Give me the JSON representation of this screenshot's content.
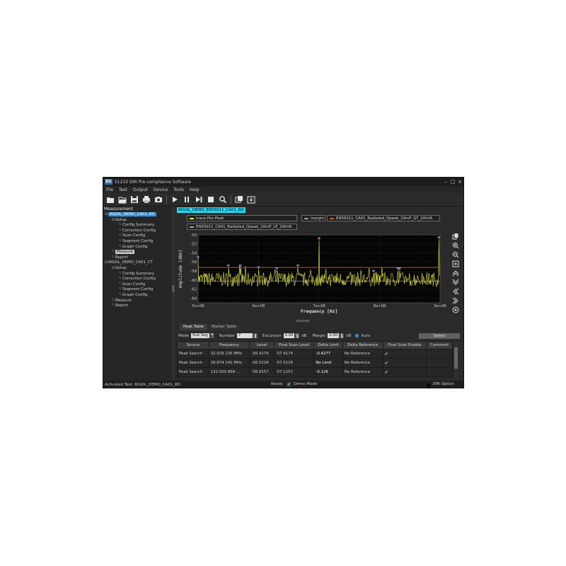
{
  "window": {
    "title": "S1210 EMI Pre-compliance Software",
    "logo": "RG"
  },
  "menu": [
    "File",
    "Test",
    "Output",
    "Device",
    "Tools",
    "Help"
  ],
  "toolbar_icons": [
    "new-folder-icon",
    "open-folder-icon",
    "save-icon",
    "print-icon",
    "camera-icon",
    "play-icon",
    "pause-icon",
    "step-icon",
    "stop-icon",
    "zoom-search-icon",
    "copy-window-icon",
    "export-icon"
  ],
  "tree": {
    "header": "Measurement",
    "nodes": [
      {
        "label": "RIGOL_DEMO_CA01_RD",
        "indent": 0,
        "toggle": "⊟",
        "state": "selected-blue"
      },
      {
        "label": "Setup",
        "indent": 1,
        "toggle": "⊟"
      },
      {
        "label": "Config Summary",
        "indent": 2
      },
      {
        "label": "Correction Config",
        "indent": 2
      },
      {
        "label": "Scan Config",
        "indent": 2
      },
      {
        "label": "Segment Config",
        "indent": 2
      },
      {
        "label": "Graph Config",
        "indent": 2
      },
      {
        "label": "Measure",
        "indent": 1,
        "state": "selected-gray"
      },
      {
        "label": "Report",
        "indent": 1
      },
      {
        "label": "RIGOL_DEMO_CA01_CT",
        "indent": 0,
        "toggle": "⊟"
      },
      {
        "label": "Setup",
        "indent": 1,
        "toggle": "⊟"
      },
      {
        "label": "Config Summary",
        "indent": 2
      },
      {
        "label": "Correction Config",
        "indent": 2
      },
      {
        "label": "Scan Config",
        "indent": 2
      },
      {
        "label": "Segment Config",
        "indent": 2
      },
      {
        "label": "Graph Config",
        "indent": 2
      },
      {
        "label": "Measure",
        "indent": 1
      },
      {
        "label": "Report",
        "indent": 1
      }
    ]
  },
  "active_test_badge": "RIGOL_DEMO_EN55011_CA01_RD",
  "legend": {
    "trace": "trace-Pos Peak",
    "margin": "margin",
    "limit1": "EN55011_CA01_Radiated_Qpeak_10mP_GT_20kVA",
    "limit2": "EN55011_CA01_Radiated_Qpeak_10mP_LE_20kVA"
  },
  "colors": {
    "trace": "#e8e84a",
    "limit1": "#d06030",
    "limit2": "#d9a35c",
    "margin": "#9a9a9a",
    "marker": "#3b6fe0",
    "marker_top": "#c040c0"
  },
  "chart_data": {
    "type": "line",
    "xlabel": "Frequency [Hz]",
    "ylabel": "Amplitude [dBm]",
    "xlim": [
      500000000,
      900000000
    ],
    "ylim": [
      -65,
      -50
    ],
    "x_ticks": [
      {
        "v": 500000000,
        "label": "5e+08"
      },
      {
        "v": 600000000,
        "label": "6e+08"
      },
      {
        "v": 700000000,
        "label": "7e+08"
      },
      {
        "v": 800000000,
        "label": "8e+08"
      },
      {
        "v": 900000000,
        "label": "9e+08"
      }
    ],
    "y_ticks": [
      -50,
      -52,
      -54,
      -56,
      -58,
      -60,
      -62,
      -64
    ],
    "limit_level": -57.2,
    "margin_level": -60.2,
    "noise_base": -59.8,
    "markers": [
      {
        "x": 500000000,
        "y": -55.4
      },
      {
        "x": 550000000,
        "y": -57.2
      },
      {
        "x": 570000000,
        "y": -57.2
      },
      {
        "x": 600000000,
        "y": -57.6
      },
      {
        "x": 630000000,
        "y": -57.8
      },
      {
        "x": 665000000,
        "y": -57.2
      },
      {
        "x": 700000000,
        "y": -51.2
      },
      {
        "x": 790000000,
        "y": -58.4
      },
      {
        "x": 830000000,
        "y": -57.8
      },
      {
        "x": 833000000,
        "y": -57.9
      },
      {
        "x": 898000000,
        "y": -51.0
      }
    ]
  },
  "side_tools": [
    "copy-icon",
    "zoom-in-icon",
    "zoom-out-icon",
    "fit-icon",
    "up-icon",
    "down-icon",
    "left-icon",
    "right-icon",
    "add-icon"
  ],
  "tabs": [
    "Peak Table",
    "Marker Table"
  ],
  "controls": {
    "mode_label": "Mode",
    "mode_value": "Sub Seg",
    "number_label": "Number",
    "number_value": "7",
    "excursion_label": "Excursion",
    "excursion_value": "0.00",
    "excursion_unit": "dB",
    "margin_label": "Margin",
    "margin_value": "0.00",
    "margin_unit": "dB",
    "auto_label": "Auto",
    "select_label": "Select"
  },
  "table": {
    "columns": [
      "Source",
      "Frequency",
      "Level",
      "Final Scan Level",
      "Delta Limit",
      "Delta Reference",
      "Final Scan Enable",
      "Comment"
    ],
    "rows": [
      [
        "Peak Search",
        "32.929 135 MHz",
        "-56.4174",
        "-57.4174",
        "-0.4277",
        "No Reference",
        "✔",
        ""
      ],
      [
        "Peak Search",
        "26.974 141 MHz",
        "-56.5126",
        "-57.0126",
        "No Limit",
        "No Reference",
        "✔",
        ""
      ],
      [
        "Peak Search",
        "132.509 868 ...",
        "-56.6157",
        "-57.1157",
        "-0.126",
        "No Reference",
        "✔",
        ""
      ],
      [
        "Peak Search",
        "139.194 837 ...",
        "-56.6873",
        "-56.6873",
        "-2.9684",
        "No Reference",
        "✔",
        ""
      ]
    ]
  },
  "status": {
    "active_test": "Activated Test: RIGOL_DEMO_CA01_RD",
    "ready": "Ready",
    "demo": "Demo Mode",
    "emi": "EMI Option"
  }
}
